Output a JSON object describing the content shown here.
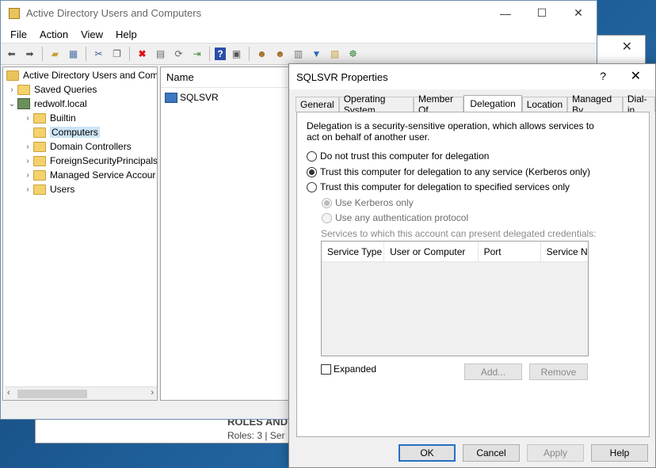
{
  "main_window": {
    "title": "Active Directory Users and Computers",
    "menu": [
      "File",
      "Action",
      "View",
      "Help"
    ],
    "toolbar_icons": [
      "back-icon",
      "forward-icon",
      "up-folder-icon",
      "show-hide-tree-icon",
      "cut-icon",
      "copy-icon",
      "delete-icon",
      "properties-icon",
      "refresh-icon",
      "export-icon",
      "help-icon",
      "console-icon",
      "new-user-icon",
      "new-group-icon",
      "new-ou-icon",
      "filter-icon",
      "find-icon",
      "add-to-group-icon"
    ]
  },
  "tree": {
    "root": "Active Directory Users and Com",
    "saved_queries": "Saved Queries",
    "domain": "redwolf.local",
    "children": [
      "Builtin",
      "Computers",
      "Domain Controllers",
      "ForeignSecurityPrincipals",
      "Managed Service Accour",
      "Users"
    ],
    "selected": "Computers"
  },
  "list": {
    "column": "Name",
    "rows": [
      "SQLSVR"
    ]
  },
  "background_window": {
    "roles_title": "ROLES AND",
    "roles_sub": "Roles: 3   |   Ser"
  },
  "dialog": {
    "title": "SQLSVR Properties",
    "help_symbol": "?",
    "tabs": [
      "General",
      "Operating System",
      "Member Of",
      "Delegation",
      "Location",
      "Managed By",
      "Dial-in"
    ],
    "active_tab": "Delegation",
    "description": "Delegation is a security-sensitive operation, which allows services to act on behalf of another user.",
    "options": {
      "no_trust": "Do not trust this computer for delegation",
      "trust_any": "Trust this computer for delegation to any service (Kerberos only)",
      "trust_specified": "Trust this computer for delegation to specified services only",
      "kerberos_only": "Use Kerberos only",
      "any_protocol": "Use any authentication protocol"
    },
    "selected_option": "trust_any",
    "services_label": "Services to which this account can present delegated credentials:",
    "columns": [
      "Service Type",
      "User or Computer",
      "Port",
      "Service Na"
    ],
    "expanded_label": "Expanded",
    "add_button": "Add...",
    "remove_button": "Remove",
    "buttons": {
      "ok": "OK",
      "cancel": "Cancel",
      "apply": "Apply",
      "help": "Help"
    }
  },
  "colors": {
    "selection": "#cce4f7",
    "accent": "#2670c0"
  }
}
